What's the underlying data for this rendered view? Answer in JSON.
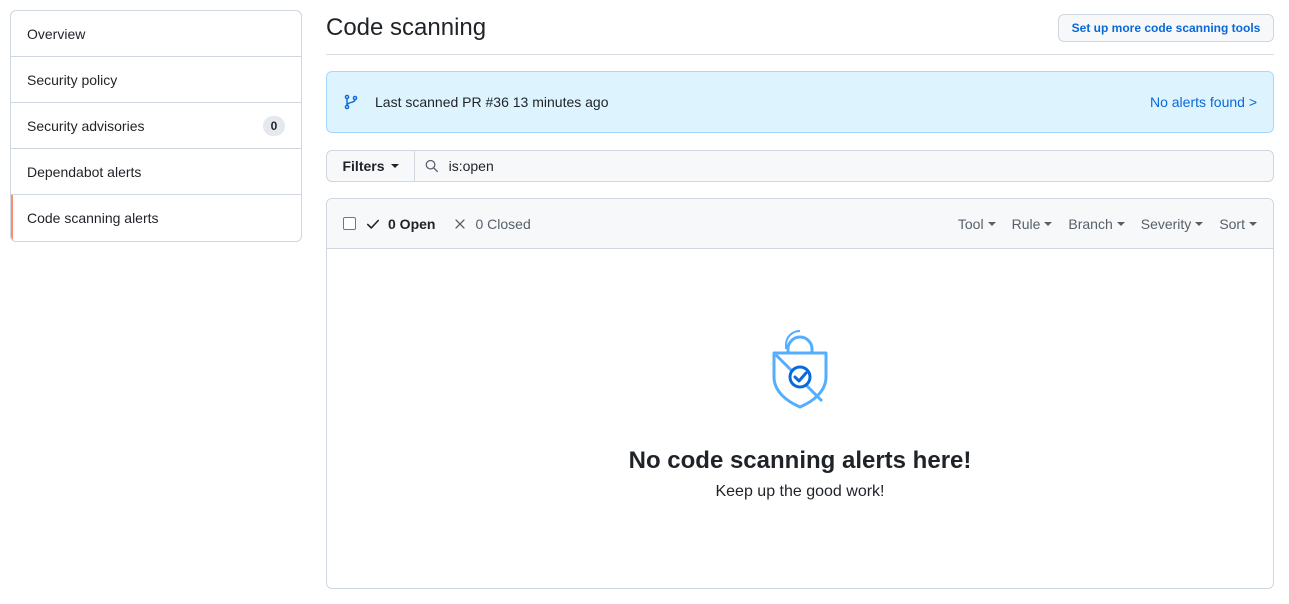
{
  "sidebar": {
    "items": [
      {
        "label": "Overview"
      },
      {
        "label": "Security policy"
      },
      {
        "label": "Security advisories",
        "count": "0"
      },
      {
        "label": "Dependabot alerts"
      },
      {
        "label": "Code scanning alerts",
        "active": true
      }
    ]
  },
  "header": {
    "title": "Code scanning",
    "setup_button": "Set up more code scanning tools"
  },
  "banner": {
    "icon": "git-branch-icon",
    "text": "Last scanned PR #36 13 minutes ago",
    "link": "No alerts found >"
  },
  "filter": {
    "button": "Filters",
    "query": "is:open"
  },
  "results": {
    "open_label": "0 Open",
    "closed_label": "0 Closed",
    "filters": [
      "Tool",
      "Rule",
      "Branch",
      "Severity",
      "Sort"
    ],
    "empty_title": "No code scanning alerts here!",
    "empty_subtitle": "Keep up the good work!"
  },
  "colors": {
    "accent": "#0969da",
    "banner_bg": "#ddf4ff",
    "active_marker": "#fd8c73"
  }
}
